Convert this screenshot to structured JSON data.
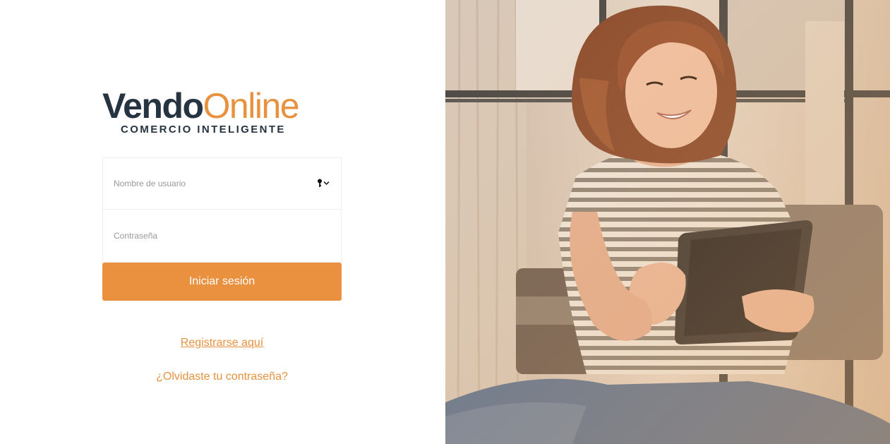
{
  "logo": {
    "part1": "Vendo",
    "part2": "Online",
    "tagline": "COMERCIO INTELIGENTE"
  },
  "form": {
    "username_placeholder": "Nombre de usuario",
    "username_value": "",
    "password_placeholder": "Contraseña",
    "password_value": "",
    "login_label": "Iniciar sesión"
  },
  "links": {
    "register": "Registrarse aquí",
    "forgot": "¿Olvidaste tu contraseña?"
  },
  "icons": {
    "username_field": [
      "key-icon",
      "chevron-down-icon"
    ],
    "hero": "woman-with-tablet-photo"
  },
  "colors": {
    "brand_dark": "#263340",
    "brand_orange": "#e9913f",
    "field_border": "#eeeeee"
  }
}
